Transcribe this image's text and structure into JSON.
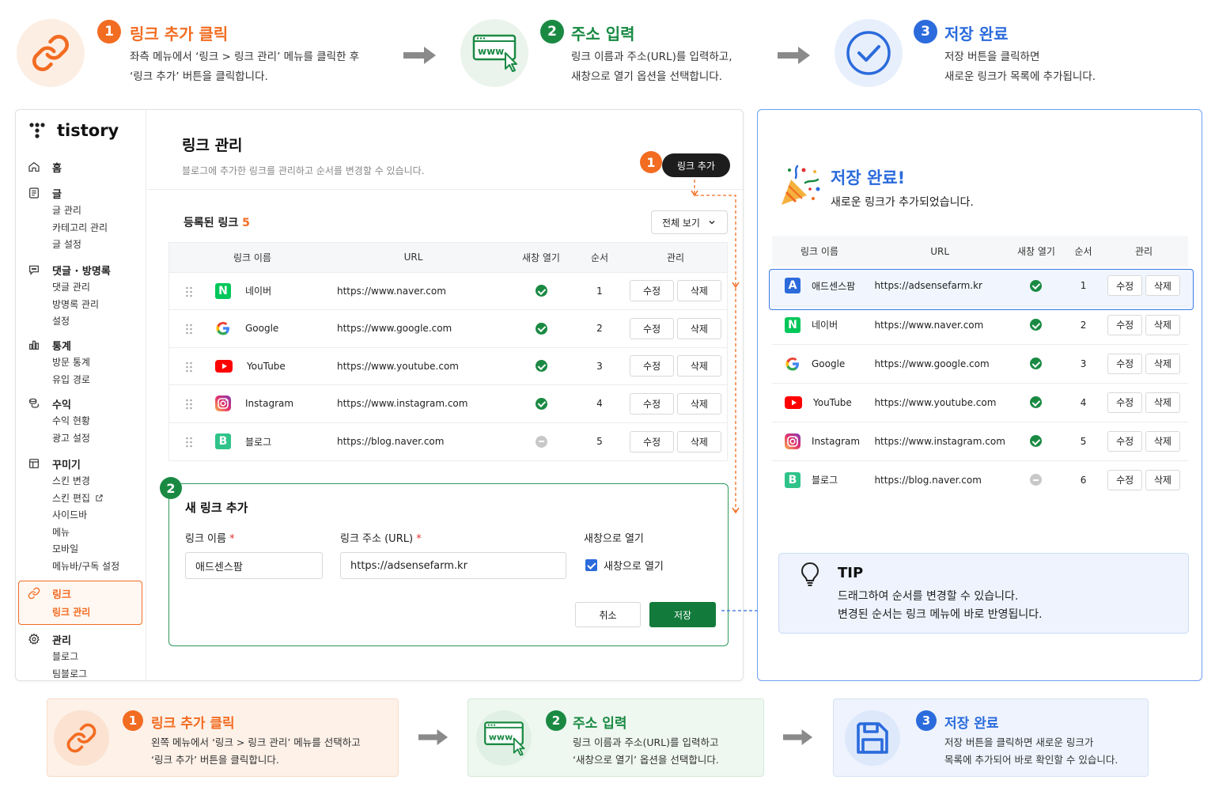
{
  "top_steps": [
    {
      "num": "1",
      "title": "링크 추가 클릭",
      "line1": "좌측 메뉴에서 ‘링크 > 링크 관리’ 메뉴를 클릭한 후",
      "line2": "‘링크 추가’ 버튼을 클릭합니다.",
      "icon": "link-icon"
    },
    {
      "num": "2",
      "title": "주소 입력",
      "line1": "링크 이름과 주소(URL)를 입력하고,",
      "line2": "새창으로 열기 옵션을 선택합니다.",
      "icon": "www-browser-icon"
    },
    {
      "num": "3",
      "title": "저장 완료",
      "line1": "저장 버튼을 클릭하면",
      "line2": "새로운 링크가 목록에 추가됩니다.",
      "icon": "check-circle-icon"
    }
  ],
  "colors": {
    "orange": "#f26c21",
    "green": "#1a8a43",
    "blue": "#2b6bdc",
    "dark": "#1d1d1d"
  },
  "sidebar": {
    "logo": "tistory",
    "sections": [
      {
        "label": "홈",
        "icon": "home-icon",
        "items": []
      },
      {
        "label": "글",
        "icon": "document-icon",
        "items": [
          "글 관리",
          "카테고리 관리",
          "글 설정"
        ]
      },
      {
        "label": "댓글 · 방명록",
        "icon": "comment-icon",
        "items": [
          "댓글 관리",
          "방명록 관리",
          "설정"
        ]
      },
      {
        "label": "통계",
        "icon": "chart-icon",
        "items": [
          "방문 통계",
          "유입 경로"
        ]
      },
      {
        "label": "수익",
        "icon": "coins-icon",
        "items": [
          "수익 현황",
          "광고 설정"
        ]
      },
      {
        "label": "꾸미기",
        "icon": "layout-icon",
        "items": [
          "스킨 변경",
          "스킨 편집",
          "사이드바",
          "메뉴",
          "모바일",
          "메뉴바/구독 설정"
        ]
      },
      {
        "label": "링크",
        "icon": "link-icon",
        "items": [
          "링크 관리"
        ]
      },
      {
        "label": "관리",
        "icon": "gear-icon",
        "items": [
          "블로그",
          "팀블로그"
        ]
      }
    ]
  },
  "main": {
    "title": "링크 관리",
    "subtitle": "블로그에 추가한 링크를 관리하고 순서를 변경할 수 있습니다.",
    "step_badge": "1",
    "add_button": "링크 추가",
    "registered_label": "등록된 링크",
    "registered_count": "5",
    "filter": "전체 보기",
    "columns": [
      "링크 이름",
      "URL",
      "새창 열기",
      "순서",
      "관리"
    ],
    "rows": [
      {
        "name": "네이버",
        "url": "https://www.naver.com",
        "newwin": true,
        "order": "1"
      },
      {
        "name": "Google",
        "url": "https://www.google.com",
        "newwin": true,
        "order": "2"
      },
      {
        "name": "YouTube",
        "url": "https://www.youtube.com",
        "newwin": true,
        "order": "3"
      },
      {
        "name": "Instagram",
        "url": "https://www.instagram.com",
        "newwin": true,
        "order": "4"
      },
      {
        "name": "블로그",
        "url": "https://blog.naver.com",
        "newwin": false,
        "order": "5"
      }
    ],
    "edit_label": "수정",
    "delete_label": "삭제"
  },
  "form": {
    "step_badge": "2",
    "title": "새 링크 추가",
    "name_label": "링크 이름",
    "url_label": "링크 주소 (URL)",
    "required_mark": "*",
    "newwin_label": "새창으로 열기",
    "name_value": "애드센스팜",
    "url_value": "https://adsensefarm.kr",
    "checkbox_label": "새창으로 열기",
    "cancel": "취소",
    "save": "저장"
  },
  "result": {
    "title": "저장 완료!",
    "subtitle": "새로운 링크가 추가되었습니다.",
    "columns": [
      "링크 이름",
      "URL",
      "새창 열기",
      "순서",
      "관리"
    ],
    "rows": [
      {
        "name": "애드센스팜",
        "url": "https://adsensefarm.kr",
        "newwin": true,
        "order": "1"
      },
      {
        "name": "네이버",
        "url": "https://www.naver.com",
        "newwin": true,
        "order": "2"
      },
      {
        "name": "Google",
        "url": "https://www.google.com",
        "newwin": true,
        "order": "3"
      },
      {
        "name": "YouTube",
        "url": "https://www.youtube.com",
        "newwin": true,
        "order": "4"
      },
      {
        "name": "Instagram",
        "url": "https://www.instagram.com",
        "newwin": true,
        "order": "5"
      },
      {
        "name": "블로그",
        "url": "https://blog.naver.com",
        "newwin": false,
        "order": "6"
      }
    ],
    "edit_label": "수정",
    "delete_label": "삭제"
  },
  "tip": {
    "title": "TIP",
    "line1": "드래그하여 순서를 변경할 수 있습니다.",
    "line2": "변경된 순서는 링크 메뉴에 바로 반영됩니다."
  },
  "bottom_steps": [
    {
      "num": "1",
      "title": "링크 추가 클릭",
      "line1": "왼쪽 메뉴에서 ‘링크 > 링크 관리’ 메뉴를 선택하고",
      "line2": "‘링크 추가’ 버튼을 클릭합니다."
    },
    {
      "num": "2",
      "title": "주소 입력",
      "line1": "링크 이름과 주소(URL)를 입력하고",
      "line2": "‘새창으로 열기’ 옵션을 선택합니다."
    },
    {
      "num": "3",
      "title": "저장 완료",
      "line1": "저장 버튼을 클릭하면 새로운 링크가",
      "line2": "목록에 추가되어 바로 확인할 수 있습니다."
    }
  ]
}
